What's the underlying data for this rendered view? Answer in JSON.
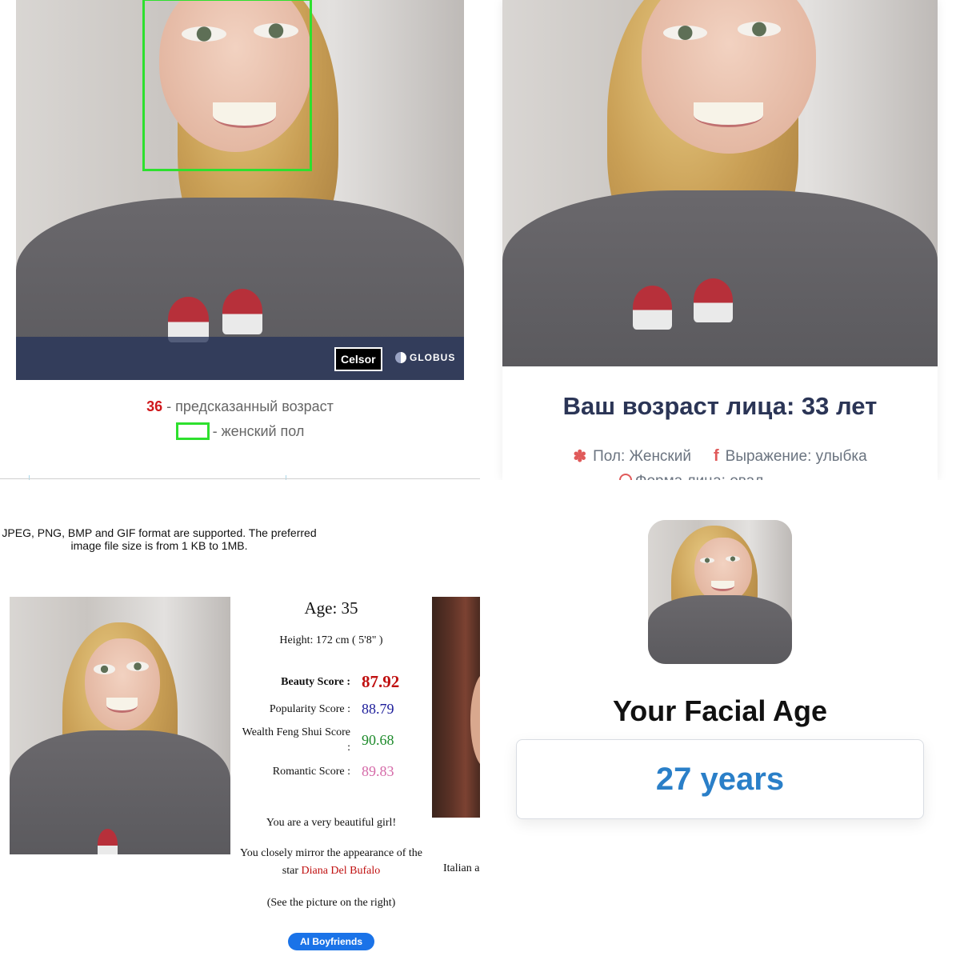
{
  "panel_top_left": {
    "watermarks": {
      "celsor": "Celsor",
      "globus": "GLOBUS"
    },
    "predicted_age": "36",
    "predicted_age_label": "- предсказанный возраст",
    "gender_label": "- женский пол",
    "accent_colors": {
      "face_box": "#2ee02e",
      "age_number": "#d0181c"
    }
  },
  "panel_top_right": {
    "title": "Ваш возраст лица: 33 лет",
    "gender": "Пол: Женский",
    "expression": "Выражение: улыбка",
    "face_shape_partial": "Форма лица: овал",
    "icons": [
      "gear-icon",
      "facebook-icon",
      "face-shape-icon"
    ]
  },
  "panel_bottom_left": {
    "formats_note": "JPEG, PNG, BMP and GIF format are supported. The preferred image file size is from 1 KB to 1MB.",
    "age": "Age: 35",
    "height": "Height: 172 cm ( 5'8\" )",
    "scores": {
      "beauty_label": "Beauty Score :",
      "beauty_value": "87.92",
      "popularity_label": "Popularity Score :",
      "popularity_value": "88.79",
      "wealth_label": "Wealth Feng Shui Score :",
      "wealth_value": "90.68",
      "romantic_label": "Romantic Score :",
      "romantic_value": "89.83"
    },
    "compliment": "You are a very beautiful girl!",
    "mirror_text": "You closely mirror the appearance of the star",
    "star_name": "Diana Del Bufalo",
    "see_picture": "(See the picture on the right)",
    "ai_button": "AI Boyfriends",
    "celebrity_caption_partial": "Italian a"
  },
  "panel_bottom_right": {
    "heading": "Your Facial Age",
    "result": "27 years",
    "accent_color": "#2a7fc8"
  }
}
